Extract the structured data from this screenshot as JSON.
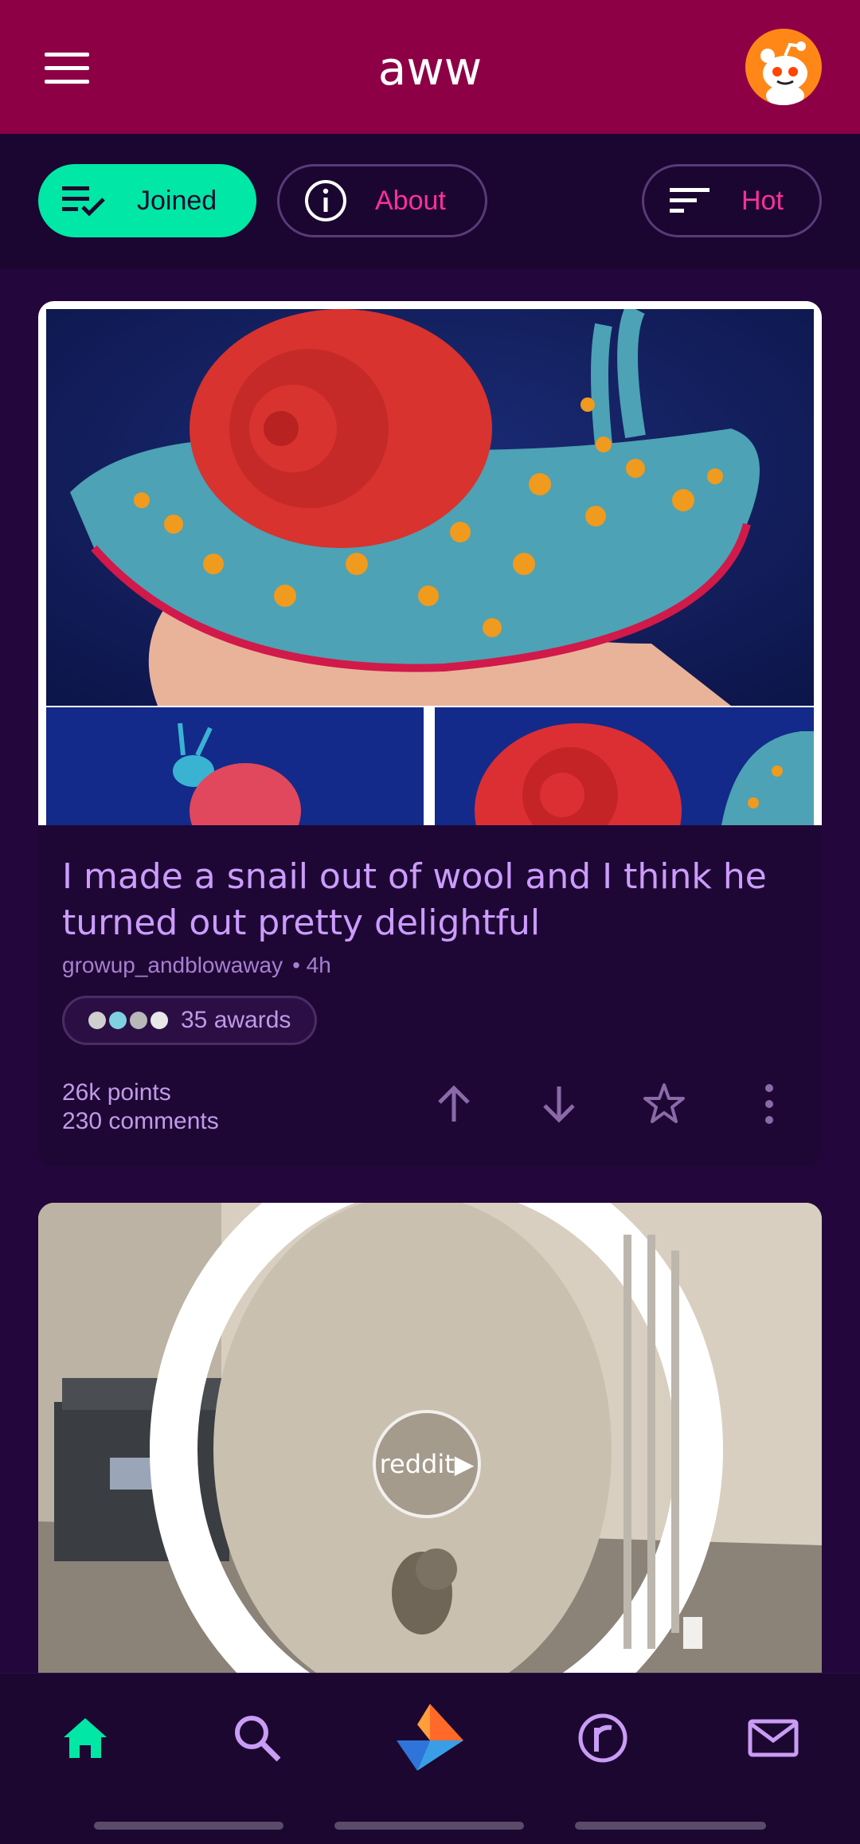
{
  "appbar": {
    "title": "aww",
    "bg_color": "#8e0046"
  },
  "filters": {
    "joined_label": "Joined",
    "about_label": "About",
    "sort_label": "Hot",
    "accent_color": "#00e7a6",
    "link_color": "#ff2f9e"
  },
  "post1": {
    "title": "I made a snail out of wool and I think he turned out pretty delightful",
    "author": "growup_andblowaway",
    "age": "• 4h",
    "awards_label": "35 awards",
    "points": "26k points",
    "comments": "230 comments"
  },
  "post2": {
    "badge_label": "reddit▶"
  },
  "icons": [
    "menu-icon",
    "snoo-avatar-icon",
    "joined-check-icon",
    "info-icon",
    "sort-icon",
    "upvote-icon",
    "downvote-icon",
    "star-icon",
    "more-vert-icon",
    "home-icon",
    "search-icon",
    "relay-logo-icon",
    "reddit-r-icon",
    "mail-icon"
  ]
}
